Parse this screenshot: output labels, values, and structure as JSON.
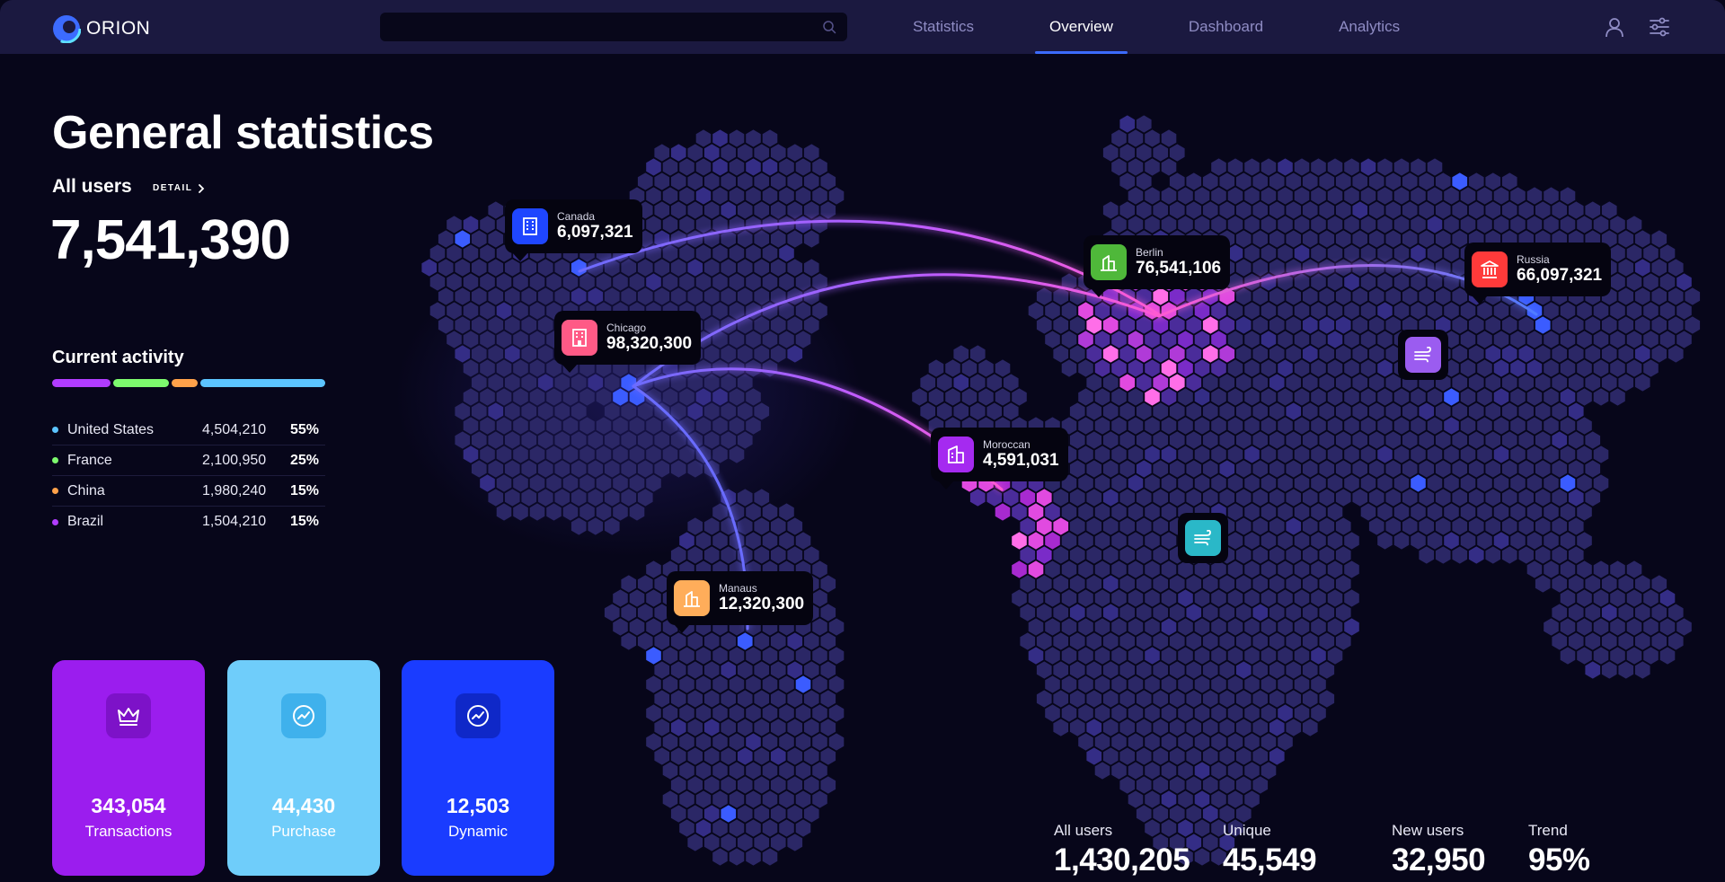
{
  "app": {
    "name": "ORION",
    "accent": "#3c6bff"
  },
  "search": {
    "placeholder": ""
  },
  "nav": {
    "tabs": [
      {
        "label": "Statistics",
        "active": false
      },
      {
        "label": "Overview",
        "active": true
      },
      {
        "label": "Dashboard",
        "active": false
      },
      {
        "label": "Analytics",
        "active": false
      }
    ],
    "icons": [
      "user-icon",
      "settings-sliders-icon"
    ]
  },
  "main": {
    "title": "General statistics",
    "all_users": {
      "label": "All users",
      "detail_label": "DETAIL",
      "value": "7,541,390"
    },
    "activity": {
      "title": "Current activity",
      "segments": [
        {
          "color": "#b13cff",
          "share": 22
        },
        {
          "color": "#7dfa6e",
          "share": 21
        },
        {
          "color": "#ffa14a",
          "share": 10
        },
        {
          "color": "#5cc4ff",
          "share": 47
        }
      ],
      "countries": [
        {
          "name": "United States",
          "value": "4,504,210",
          "percent": "55%",
          "color": "#5cc4ff"
        },
        {
          "name": "France",
          "value": "2,100,950",
          "percent": "25%",
          "color": "#7dfa6e"
        },
        {
          "name": "China",
          "value": "1,980,240",
          "percent": "15%",
          "color": "#ffa14a"
        },
        {
          "name": "Brazil",
          "value": "1,504,210",
          "percent": "15%",
          "color": "#b13cff"
        }
      ]
    },
    "cards": [
      {
        "value": "343,054",
        "label": "Transactions",
        "color": "#9b1dee",
        "icon": "crown-icon"
      },
      {
        "value": "44,430",
        "label": "Purchase",
        "color": "#6fcdfa",
        "icon": "trend-circle-icon"
      },
      {
        "value": "12,503",
        "label": "Dynamic",
        "color": "#1a3cff",
        "icon": "trend-circle-icon"
      }
    ]
  },
  "map": {
    "cities": [
      {
        "name": "Canada",
        "value": "6,097,321",
        "color": "#1f46ff",
        "icon": "office-building-icon"
      },
      {
        "name": "Chicago",
        "value": "98,320,300",
        "color": "#ff5a86",
        "icon": "office-building-icon"
      },
      {
        "name": "Berlin",
        "value": "76,541,106",
        "color": "#4fb83a",
        "icon": "buildings-icon"
      },
      {
        "name": "Russia",
        "value": "66,097,321",
        "color": "#ff3a3a",
        "icon": "bank-icon"
      },
      {
        "name": "Moroccan",
        "value": "4,591,031",
        "color": "#a52af0",
        "icon": "buildings-icon"
      },
      {
        "name": "Manaus",
        "value": "12,320,300",
        "color": "#ffad5a",
        "icon": "buildings-icon"
      }
    ],
    "markers": [
      {
        "color": "#9b5cf0",
        "icon": "wind-icon"
      },
      {
        "color": "#2ab8c8",
        "icon": "wind-icon"
      }
    ]
  },
  "bottom_stats": [
    {
      "label": "All users",
      "value": "1,430,205"
    },
    {
      "label": "Unique",
      "value": "45,549"
    },
    {
      "label": "New users",
      "value": "32,950"
    },
    {
      "label": "Trend",
      "value": "95%"
    }
  ]
}
